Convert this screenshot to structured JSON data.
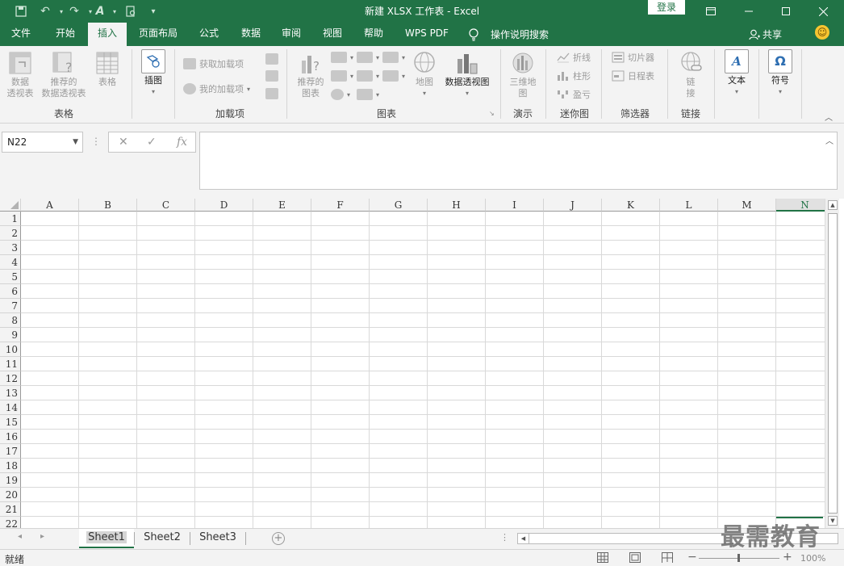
{
  "titlebar": {
    "title": "新建 XLSX 工作表  -  Excel",
    "login": "登录"
  },
  "tabs": [
    {
      "label": "文件",
      "active": false
    },
    {
      "label": "开始",
      "active": false
    },
    {
      "label": "插入",
      "active": true
    },
    {
      "label": "页面布局",
      "active": false
    },
    {
      "label": "公式",
      "active": false
    },
    {
      "label": "数据",
      "active": false
    },
    {
      "label": "审阅",
      "active": false
    },
    {
      "label": "视图",
      "active": false
    },
    {
      "label": "帮助",
      "active": false
    },
    {
      "label": "WPS PDF",
      "active": false
    }
  ],
  "tell_me": "操作说明搜索",
  "share": "共享",
  "ribbon": {
    "groups": {
      "tables": "表格",
      "addins": "加载项",
      "charts": "图表",
      "tours": "演示",
      "sparklines": "迷你图",
      "filters": "筛选器",
      "links": "链接"
    },
    "pivot_table": "数据\n透视表",
    "recommended_pivot": "推荐的\n数据透视表",
    "table": "表格",
    "illustrations": "插图",
    "get_addins": "获取加载项",
    "my_addins": "我的加载项",
    "recommended_charts": "推荐的\n图表",
    "maps": "地图",
    "pivot_chart": "数据透视图",
    "map_3d": "三维地\n图",
    "line": "折线",
    "column": "柱形",
    "win_loss": "盈亏",
    "slicer": "切片器",
    "timeline": "日程表",
    "link": "链\n接",
    "text": "文本",
    "symbol": "符号"
  },
  "namebox": "N22",
  "columns": [
    "A",
    "B",
    "C",
    "D",
    "E",
    "F",
    "G",
    "H",
    "I",
    "J",
    "K",
    "L",
    "M",
    "N"
  ],
  "selected_column": "N",
  "rows": [
    "1",
    "2",
    "3",
    "4",
    "5",
    "6",
    "7",
    "8",
    "9",
    "10",
    "11",
    "12",
    "13",
    "14",
    "15",
    "16",
    "17",
    "18",
    "19",
    "20",
    "21",
    "22"
  ],
  "sheets": [
    {
      "label": "Sheet1",
      "active": true
    },
    {
      "label": "Sheet2",
      "active": false
    },
    {
      "label": "Sheet3",
      "active": false
    }
  ],
  "status": "就绪",
  "zoom": "100%",
  "watermark": "最需教育"
}
